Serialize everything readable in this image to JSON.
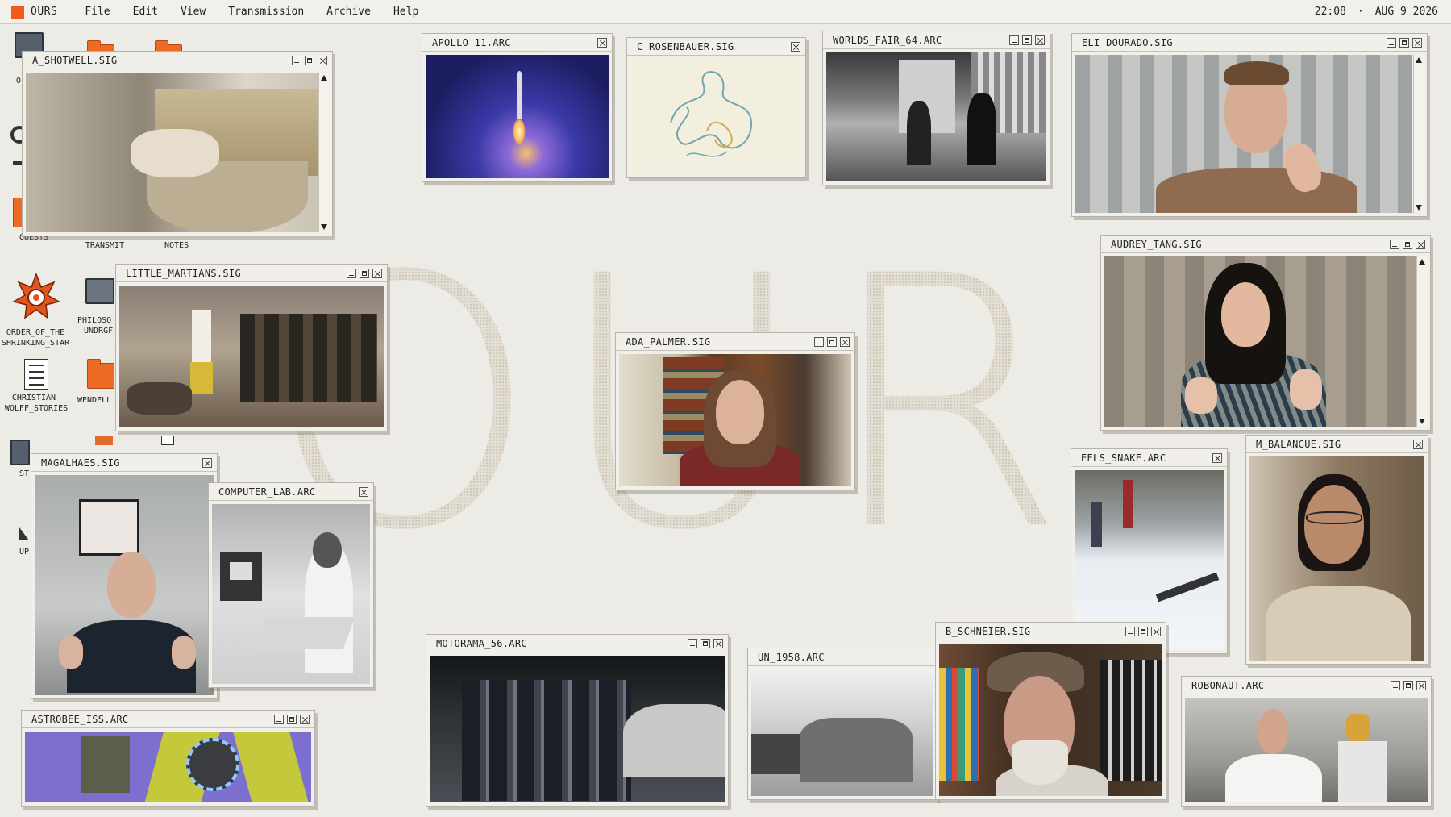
{
  "menubar": {
    "brand": "OURS",
    "menus": [
      "File",
      "Edit",
      "View",
      "Transmission",
      "Archive",
      "Help"
    ],
    "time": "22:08",
    "separator": "·",
    "date": "AUG 9 2026"
  },
  "watermark": "OURS",
  "desktop_icons": {
    "guests": "GUESTS",
    "transmit": "TRANSMIT",
    "notes": "NOTES",
    "order_line1": "ORDER_OF_THE",
    "order_line2": "SHRINKING_STAR",
    "philoso_line1": "PHILOSO",
    "philoso_line2": "UNDRGF",
    "christian_line1": "CHRISTIAN_",
    "christian_line2": "WOLFF_STORIES",
    "wendell": "WENDELL",
    "partial_o": "O",
    "partial_st": "ST",
    "partial_up": "UP"
  },
  "windows": {
    "shotwell": "A_SHOTWELL.SIG",
    "apollo": "APOLLO_11.ARC",
    "rosenbauer": "C_ROSENBAUER.SIG",
    "worlds_fair": "WORLDS_FAIR_64.ARC",
    "dourado": "ELI_DOURADO.SIG",
    "martians": "LITTLE_MARTIANS.SIG",
    "tang": "AUDREY_TANG.SIG",
    "palmer": "ADA_PALMER.SIG",
    "eels": "EELS_SNAKE.ARC",
    "balangue": "M_BALANGUE.SIG",
    "magalhaes": "MAGALHAES.SIG",
    "computer_lab": "COMPUTER_LAB.ARC",
    "motorama": "MOTORAMA_56.ARC",
    "un": "UN_1958.ARC",
    "schneier": "B_SCHNEIER.SIG",
    "robonaut": "ROBONAUT.ARC",
    "astrobee": "ASTROBEE_ISS.ARC"
  },
  "colors": {
    "accent": "#ef5b1a",
    "desktop": "#edebe5",
    "window": "#f1efe9"
  }
}
